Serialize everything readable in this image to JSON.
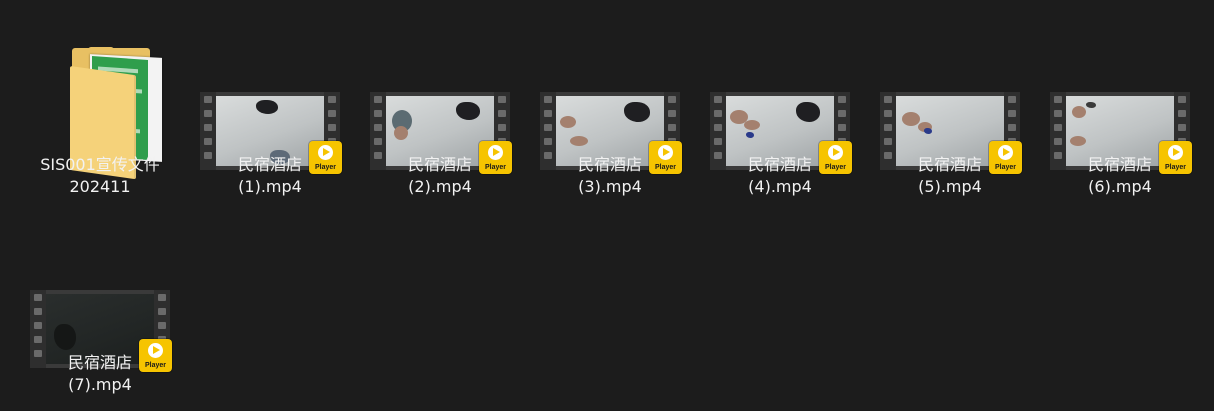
{
  "items": [
    {
      "type": "folder",
      "name_line1": "SIS001宣传文件",
      "name_line2": "202411",
      "icon": "folder-icon"
    },
    {
      "type": "video",
      "name_line1": "民宿酒店",
      "name_line2": "(1).mp4",
      "badge": "Player",
      "icon": "video-file-icon"
    },
    {
      "type": "video",
      "name_line1": "民宿酒店",
      "name_line2": "(2).mp4",
      "badge": "Player",
      "icon": "video-file-icon"
    },
    {
      "type": "video",
      "name_line1": "民宿酒店",
      "name_line2": "(3).mp4",
      "badge": "Player",
      "icon": "video-file-icon"
    },
    {
      "type": "video",
      "name_line1": "民宿酒店",
      "name_line2": "(4).mp4",
      "badge": "Player",
      "icon": "video-file-icon"
    },
    {
      "type": "video",
      "name_line1": "民宿酒店",
      "name_line2": "(5).mp4",
      "badge": "Player",
      "icon": "video-file-icon"
    },
    {
      "type": "video",
      "name_line1": "民宿酒店",
      "name_line2": "(6).mp4",
      "badge": "Player",
      "icon": "video-file-icon"
    },
    {
      "type": "video",
      "name_line1": "民宿酒店",
      "name_line2": "(7).mp4",
      "badge": "Player",
      "icon": "video-file-icon"
    }
  ],
  "colors": {
    "background": "#1c1c1c",
    "text": "#f2f2f2",
    "badge": "#f6c400",
    "folder": "#e8c063"
  }
}
